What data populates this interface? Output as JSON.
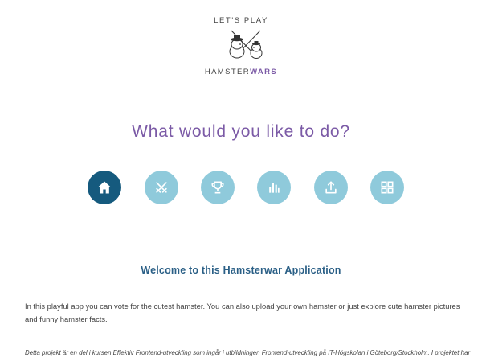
{
  "logo": {
    "top_text": "LET'S PLAY",
    "brand_part1": "HAMSTER",
    "brand_part2": "WARS"
  },
  "headline": "What would you like to do?",
  "nav": {
    "items": [
      {
        "icon": "home-icon",
        "active": true
      },
      {
        "icon": "crossed-swords-icon",
        "active": false
      },
      {
        "icon": "trophy-icon",
        "active": false
      },
      {
        "icon": "bar-chart-icon",
        "active": false
      },
      {
        "icon": "upload-icon",
        "active": false
      },
      {
        "icon": "gallery-grid-icon",
        "active": false
      }
    ]
  },
  "colors": {
    "accent_purple": "#7b5aa6",
    "nav_active": "#155a7e",
    "nav_inactive": "#8fcadb",
    "welcome_blue": "#2a5f86"
  },
  "content": {
    "welcome_title": "Welcome to this Hamsterwar Application",
    "intro": "In this playful app you can vote for the cutest hamster. You can also upload your own hamster or just explore cute hamster pictures and funny hamster facts.",
    "footnote": "Detta projekt är en del i kursen Effektiv Frontend-utveckling som ingår i utbildningen Frontend-utveckling på IT-Högskolan i Göteborg/Stockholm. I projektet har"
  }
}
